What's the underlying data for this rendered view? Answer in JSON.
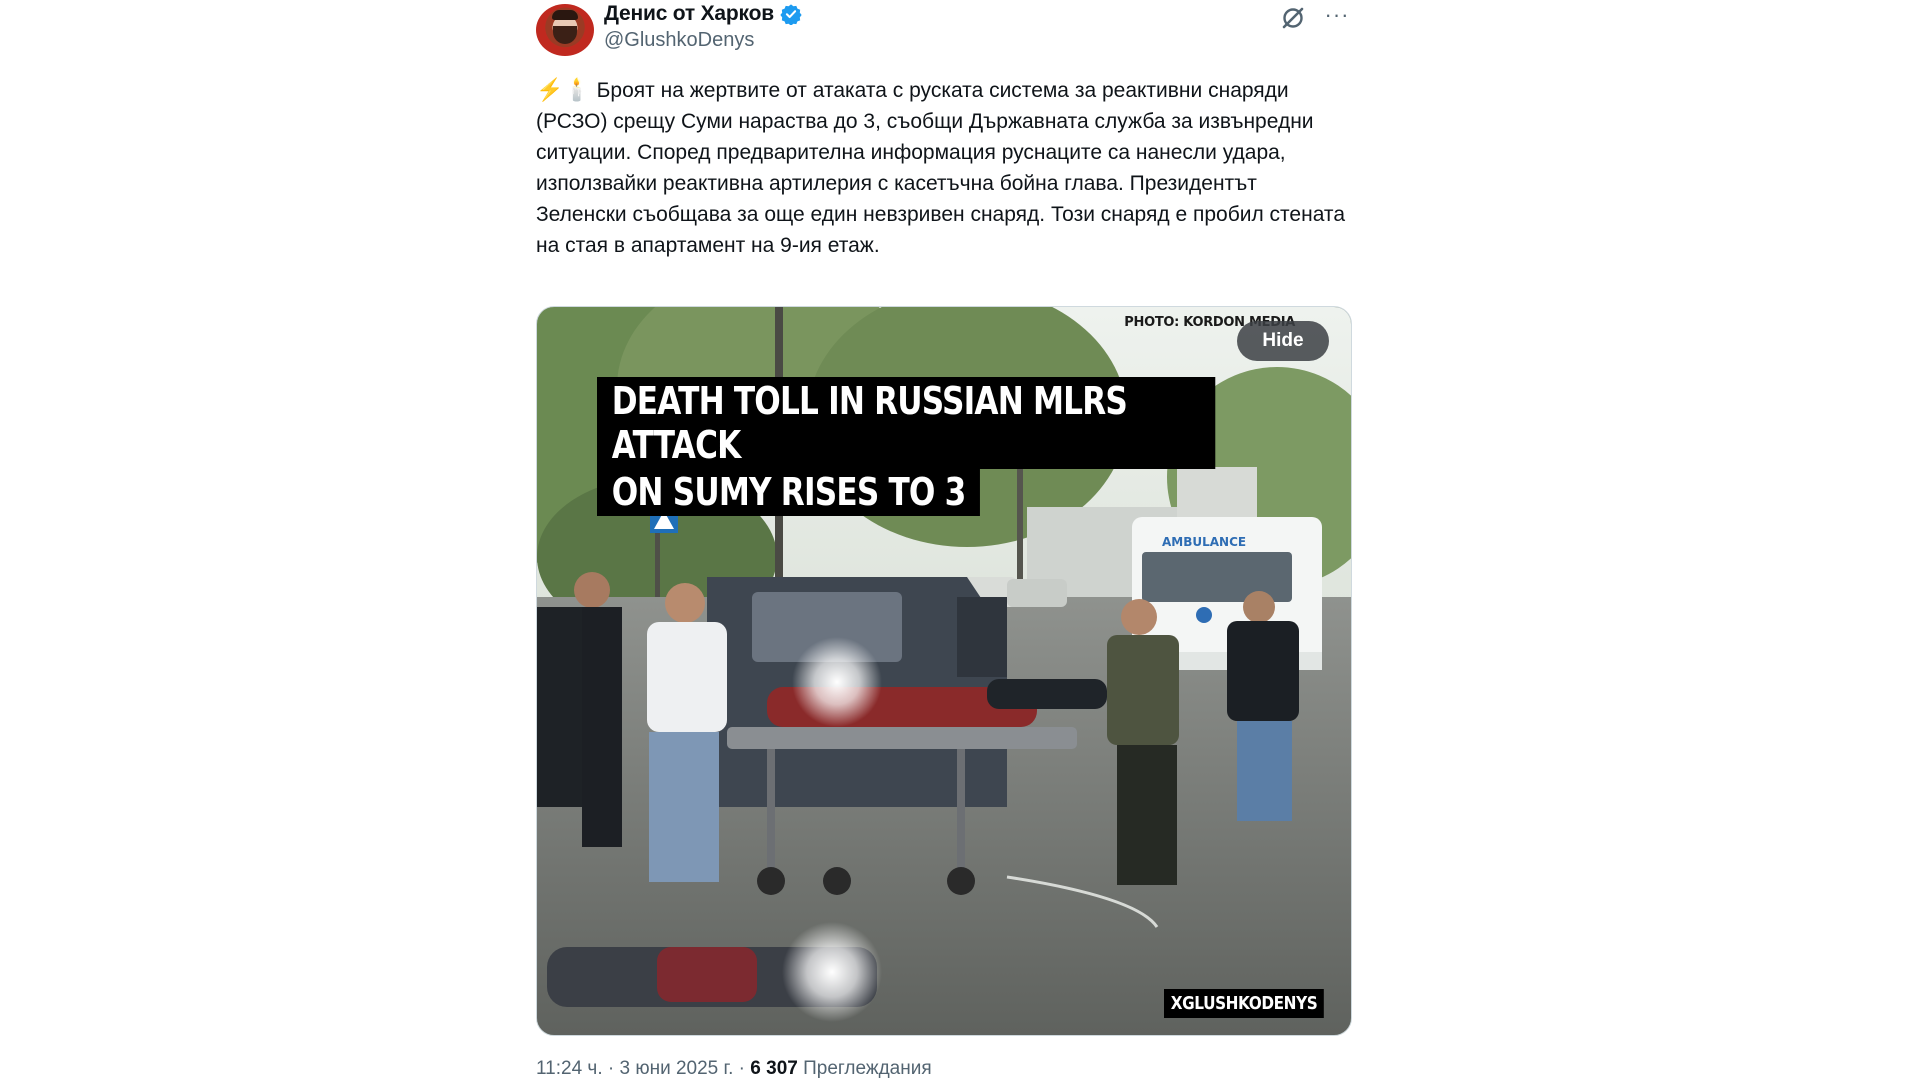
{
  "author": {
    "display_name": "Денис от Харков",
    "handle": "@GlushkoDenys",
    "verified": true,
    "avatar_icon": "profile-photo"
  },
  "actions": {
    "grok_icon": "grok-icon",
    "more_icon": "more-dots-icon",
    "more_label": "···"
  },
  "tweet": {
    "emoji_prefix": "⚡🕯️",
    "text": "Броят на жертвите от атаката с руската система за реактивни снаряди (РСЗО) срещу Суми нараства до 3, съобщи Държавната служба за извънредни ситуации. Според предварителна информация руснаците са нанесли удара, използвайки реактивна артилерия с касетъчна бойна глава. Президентът Зеленски съобщава за още един невзривен снаряд. Този снаряд е пробил стената на стая в апартамент на 9-ия етаж."
  },
  "media": {
    "photo_credit": "PHOTO: KORDON MEDIA",
    "hide_label": "Hide",
    "headline_line1": "DEATH TOLL IN RUSSIAN MLRS ATTACK",
    "headline_line2": "ON SUMY RISES TO 3",
    "vehicle_text": "AMBULANCE",
    "watermark": "XGLUSHKODENYS"
  },
  "meta": {
    "time": "11:24 ч.",
    "separator": " · ",
    "date": "3 юни 2025 г.",
    "views_count": "6 307",
    "views_label": "Преглеждания"
  },
  "colors": {
    "verified_blue": "#1d9bf0",
    "secondary_text": "#536471",
    "primary_text": "#0f1419"
  }
}
